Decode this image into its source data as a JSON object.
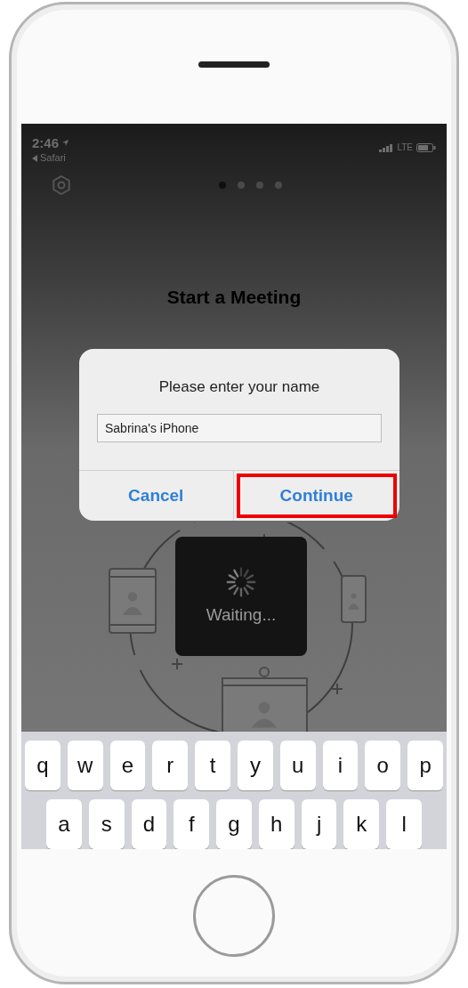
{
  "status_bar": {
    "time": "2:46",
    "back_link": "Safari",
    "network": "LTE"
  },
  "pager": [
    {
      "selected": true
    },
    {
      "selected": false
    },
    {
      "selected": false
    },
    {
      "selected": false
    }
  ],
  "title": "Start a Meeting",
  "dialog": {
    "title": "Please enter your name",
    "field": {
      "value": "Sabrina's iPhone"
    },
    "buttons": [
      {
        "label": "Cancel",
        "highlighted": false
      },
      {
        "label": "Continue",
        "highlighted": true
      }
    ]
  },
  "status_card": {
    "label": "Waiting..."
  },
  "keyboard": {
    "rows": [
      [
        "q",
        "w",
        "e",
        "r",
        "t",
        "y",
        "u",
        "i",
        "o",
        "p"
      ],
      [
        "a",
        "s",
        "d",
        "f",
        "g",
        "h",
        "j",
        "k",
        "l"
      ]
    ]
  }
}
